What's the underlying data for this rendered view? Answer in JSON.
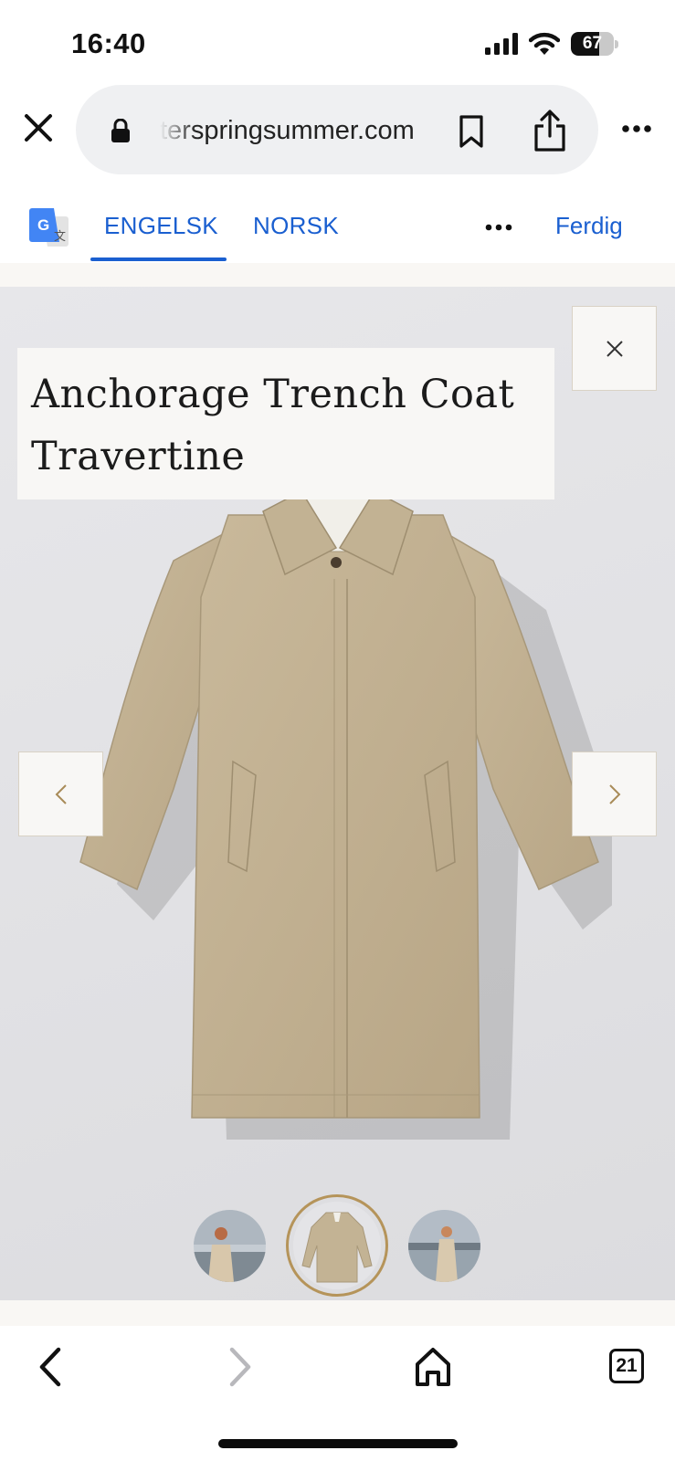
{
  "status": {
    "time": "16:40",
    "battery_level": "67",
    "battery_fraction": 0.67
  },
  "browser": {
    "url_display": "terspringsummer.com",
    "close_icon": "close-icon",
    "lock_icon": "lock-icon",
    "bookmark_icon": "bookmark-icon",
    "share_icon": "share-icon",
    "more_icon": "more-horizontal-icon"
  },
  "translate": {
    "tabs": [
      {
        "label": "ENGELSK",
        "selected": true
      },
      {
        "label": "NORSK",
        "selected": false
      }
    ],
    "done_label": "Ferdig",
    "accent_color": "#1a5fd0"
  },
  "product": {
    "title_line_1": "Anchorage Trench Coat",
    "title_line_2": "Travertine",
    "thumbnails": [
      "model-outdoor",
      "coat-flat",
      "model-lake"
    ],
    "selected_thumbnail": 1,
    "accent_color": "#b5945a"
  },
  "toolbar": {
    "tab_count": "21"
  }
}
